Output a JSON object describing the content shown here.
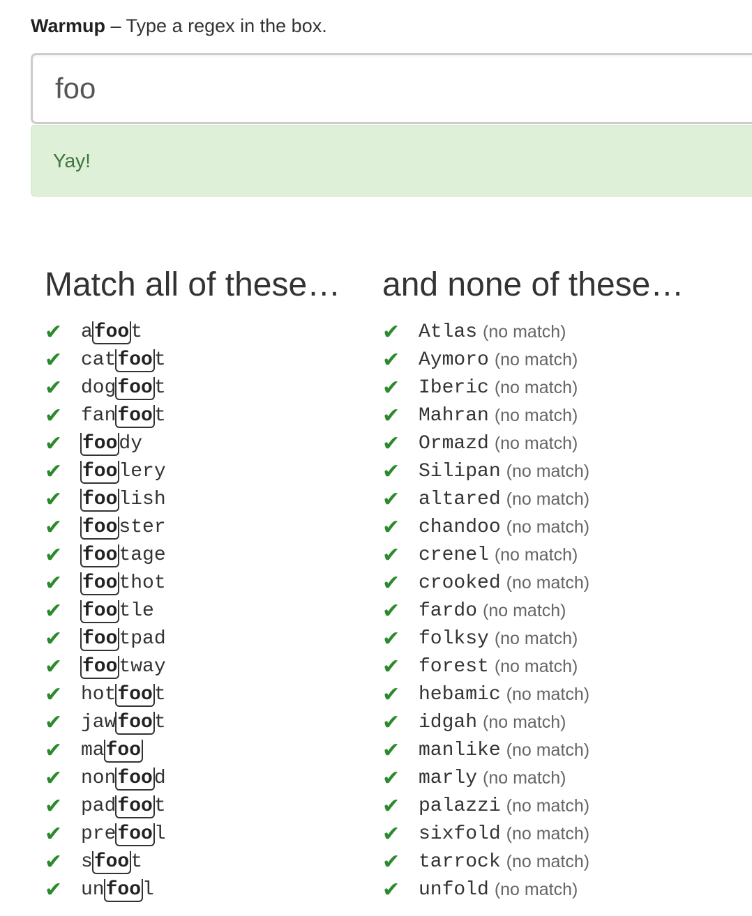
{
  "header": {
    "title_bold": "Warmup",
    "title_rest": " – Type a regex in the box."
  },
  "input": {
    "value": "foo"
  },
  "result": {
    "message": "Yay!"
  },
  "colors": {
    "check": "#2c8a2c",
    "success_bg": "#dff0d8",
    "success_text": "#3c763d"
  },
  "icons": {
    "check": "check-icon"
  },
  "match_column": {
    "heading": "Match all of these…",
    "items": [
      {
        "pre": "a",
        "match": "foo",
        "post": "t"
      },
      {
        "pre": "cat",
        "match": "foo",
        "post": "t"
      },
      {
        "pre": "dog",
        "match": "foo",
        "post": "t"
      },
      {
        "pre": "fan",
        "match": "foo",
        "post": "t"
      },
      {
        "pre": "",
        "match": "foo",
        "post": "dy"
      },
      {
        "pre": "",
        "match": "foo",
        "post": "lery"
      },
      {
        "pre": "",
        "match": "foo",
        "post": "lish"
      },
      {
        "pre": "",
        "match": "foo",
        "post": "ster"
      },
      {
        "pre": "",
        "match": "foo",
        "post": "tage"
      },
      {
        "pre": "",
        "match": "foo",
        "post": "thot"
      },
      {
        "pre": "",
        "match": "foo",
        "post": "tle"
      },
      {
        "pre": "",
        "match": "foo",
        "post": "tpad"
      },
      {
        "pre": "",
        "match": "foo",
        "post": "tway"
      },
      {
        "pre": "hot",
        "match": "foo",
        "post": "t"
      },
      {
        "pre": "jaw",
        "match": "foo",
        "post": "t"
      },
      {
        "pre": "ma",
        "match": "foo",
        "post": ""
      },
      {
        "pre": "non",
        "match": "foo",
        "post": "d"
      },
      {
        "pre": "pad",
        "match": "foo",
        "post": "t"
      },
      {
        "pre": "pre",
        "match": "foo",
        "post": "l"
      },
      {
        "pre": "s",
        "match": "foo",
        "post": "t"
      },
      {
        "pre": "un",
        "match": "foo",
        "post": "l"
      }
    ]
  },
  "nomatch_column": {
    "heading": "and none of these…",
    "label": "(no match)",
    "items": [
      "Atlas",
      "Aymoro",
      "Iberic",
      "Mahran",
      "Ormazd",
      "Silipan",
      "altared",
      "chandoo",
      "crenel",
      "crooked",
      "fardo",
      "folksy",
      "forest",
      "hebamic",
      "idgah",
      "manlike",
      "marly",
      "palazzi",
      "sixfold",
      "tarrock",
      "unfold"
    ]
  }
}
